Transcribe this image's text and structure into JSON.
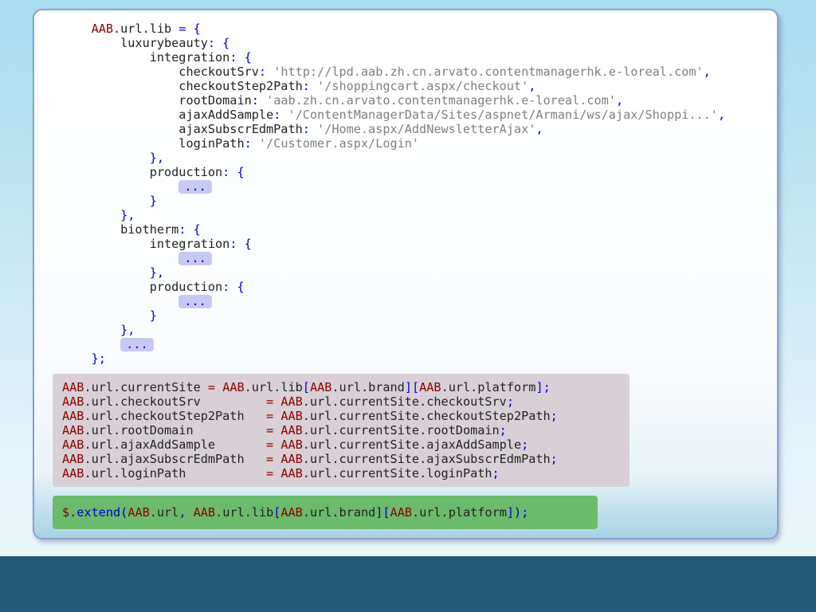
{
  "main_block": [
    [
      [
        "t",
        "    "
      ],
      [
        "k",
        "AAB"
      ],
      [
        "t",
        ".url.lib "
      ],
      [
        "p",
        "= {"
      ]
    ],
    [
      [
        "t",
        "        luxurybeauty"
      ],
      [
        "p",
        ": {"
      ]
    ],
    [
      [
        "t",
        "            integration"
      ],
      [
        "p",
        ": {"
      ]
    ],
    [
      [
        "t",
        "                checkoutSrv"
      ],
      [
        "p",
        ": "
      ],
      [
        "s",
        "'http://lpd.aab.zh.cn.arvato.contentmanagerhk.e-loreal.com'"
      ],
      [
        "p",
        ","
      ]
    ],
    [
      [
        "t",
        "                checkoutStep2Path"
      ],
      [
        "p",
        ": "
      ],
      [
        "s",
        "'/shoppingcart.aspx/checkout'"
      ],
      [
        "p",
        ","
      ]
    ],
    [
      [
        "t",
        "                rootDomain"
      ],
      [
        "p",
        ": "
      ],
      [
        "s",
        "'aab.zh.cn.arvato.contentmanagerhk.e-loreal.com'"
      ],
      [
        "p",
        ","
      ]
    ],
    [
      [
        "t",
        "                ajaxAddSample"
      ],
      [
        "p",
        ": "
      ],
      [
        "s",
        "'/ContentManagerData/Sites/aspnet/Armani/ws/ajax/Shoppi...'"
      ],
      [
        "p",
        ","
      ]
    ],
    [
      [
        "t",
        "                ajaxSubscrEdmPath"
      ],
      [
        "p",
        ": "
      ],
      [
        "s",
        "'/Home.aspx/AddNewsletterAjax'"
      ],
      [
        "p",
        ","
      ]
    ],
    [
      [
        "t",
        "                loginPath"
      ],
      [
        "p",
        ": "
      ],
      [
        "s",
        "'/Customer.aspx/Login'"
      ]
    ],
    [
      [
        "p",
        "            },"
      ]
    ],
    [
      [
        "t",
        "            production"
      ],
      [
        "p",
        ": {"
      ]
    ],
    [
      [
        "t",
        "                "
      ],
      [
        "e",
        "..."
      ]
    ],
    [
      [
        "p",
        "            }"
      ]
    ],
    [
      [
        "p",
        "        },"
      ]
    ],
    [
      [
        "t",
        "        biotherm"
      ],
      [
        "p",
        ": {"
      ]
    ],
    [
      [
        "t",
        "            integration"
      ],
      [
        "p",
        ": {"
      ]
    ],
    [
      [
        "t",
        "                "
      ],
      [
        "e",
        "..."
      ]
    ],
    [
      [
        "p",
        "            },"
      ]
    ],
    [
      [
        "t",
        "            production"
      ],
      [
        "p",
        ": {"
      ]
    ],
    [
      [
        "t",
        "                "
      ],
      [
        "e",
        "..."
      ]
    ],
    [
      [
        "p",
        "            }"
      ]
    ],
    [
      [
        "p",
        "        },"
      ]
    ],
    [
      [
        "t",
        "        "
      ],
      [
        "e",
        "..."
      ]
    ],
    [
      [
        "p",
        "    };"
      ]
    ]
  ],
  "pink_block": [
    [
      [
        "k",
        "AAB"
      ],
      [
        "t",
        ".url.currentSite "
      ],
      [
        "k",
        "="
      ],
      [
        "t",
        " "
      ],
      [
        "k",
        "AAB"
      ],
      [
        "t",
        ".url.lib"
      ],
      [
        "p",
        "["
      ],
      [
        "k",
        "AAB"
      ],
      [
        "t",
        ".url.brand"
      ],
      [
        "p",
        "]["
      ],
      [
        "k",
        "AAB"
      ],
      [
        "t",
        ".url.platform"
      ],
      [
        "p",
        "];"
      ]
    ],
    [
      [
        "k",
        "AAB"
      ],
      [
        "t",
        ".url.checkoutSrv         "
      ],
      [
        "k",
        "="
      ],
      [
        "t",
        " "
      ],
      [
        "k",
        "AAB"
      ],
      [
        "t",
        ".url.currentSite.checkoutSrv"
      ],
      [
        "p",
        ";"
      ]
    ],
    [
      [
        "k",
        "AAB"
      ],
      [
        "t",
        ".url.checkoutStep2Path   "
      ],
      [
        "k",
        "="
      ],
      [
        "t",
        " "
      ],
      [
        "k",
        "AAB"
      ],
      [
        "t",
        ".url.currentSite.checkoutStep2Path"
      ],
      [
        "p",
        ";"
      ]
    ],
    [
      [
        "k",
        "AAB"
      ],
      [
        "t",
        ".url.rootDomain          "
      ],
      [
        "k",
        "="
      ],
      [
        "t",
        " "
      ],
      [
        "k",
        "AAB"
      ],
      [
        "t",
        ".url.currentSite.rootDomain"
      ],
      [
        "p",
        ";"
      ]
    ],
    [
      [
        "k",
        "AAB"
      ],
      [
        "t",
        ".url.ajaxAddSample       "
      ],
      [
        "k",
        "="
      ],
      [
        "t",
        " "
      ],
      [
        "k",
        "AAB"
      ],
      [
        "t",
        ".url.currentSite.ajaxAddSample"
      ],
      [
        "p",
        ";"
      ]
    ],
    [
      [
        "k",
        "AAB"
      ],
      [
        "t",
        ".url.ajaxSubscrEdmPath   "
      ],
      [
        "k",
        "="
      ],
      [
        "t",
        " "
      ],
      [
        "k",
        "AAB"
      ],
      [
        "t",
        ".url.currentSite.ajaxSubscrEdmPath"
      ],
      [
        "p",
        ";"
      ]
    ],
    [
      [
        "k",
        "AAB"
      ],
      [
        "t",
        ".url.loginPath           "
      ],
      [
        "k",
        "="
      ],
      [
        "t",
        " "
      ],
      [
        "k",
        "AAB"
      ],
      [
        "t",
        ".url.currentSite.loginPath"
      ],
      [
        "p",
        ";"
      ]
    ]
  ],
  "green_block": [
    [
      [
        "k",
        "$"
      ],
      [
        "p",
        ".extend("
      ],
      [
        "k",
        "AAB"
      ],
      [
        "t",
        ".url"
      ],
      [
        "p",
        ", "
      ],
      [
        "k",
        "AAB"
      ],
      [
        "t",
        ".url.lib"
      ],
      [
        "p",
        "["
      ],
      [
        "k",
        "AAB"
      ],
      [
        "t",
        ".url.brand"
      ],
      [
        "p",
        "]["
      ],
      [
        "k",
        "AAB"
      ],
      [
        "t",
        ".url.platform"
      ],
      [
        "p",
        "]);"
      ]
    ]
  ],
  "colors": {
    "identifier": "#8b0000",
    "punctuation": "#0000c8",
    "string": "#808080",
    "ellipsis_bg": "#c8c8f4",
    "pink_panel": "#d8d0d6",
    "green_panel": "#6cba6c",
    "footer": "#245a78"
  }
}
